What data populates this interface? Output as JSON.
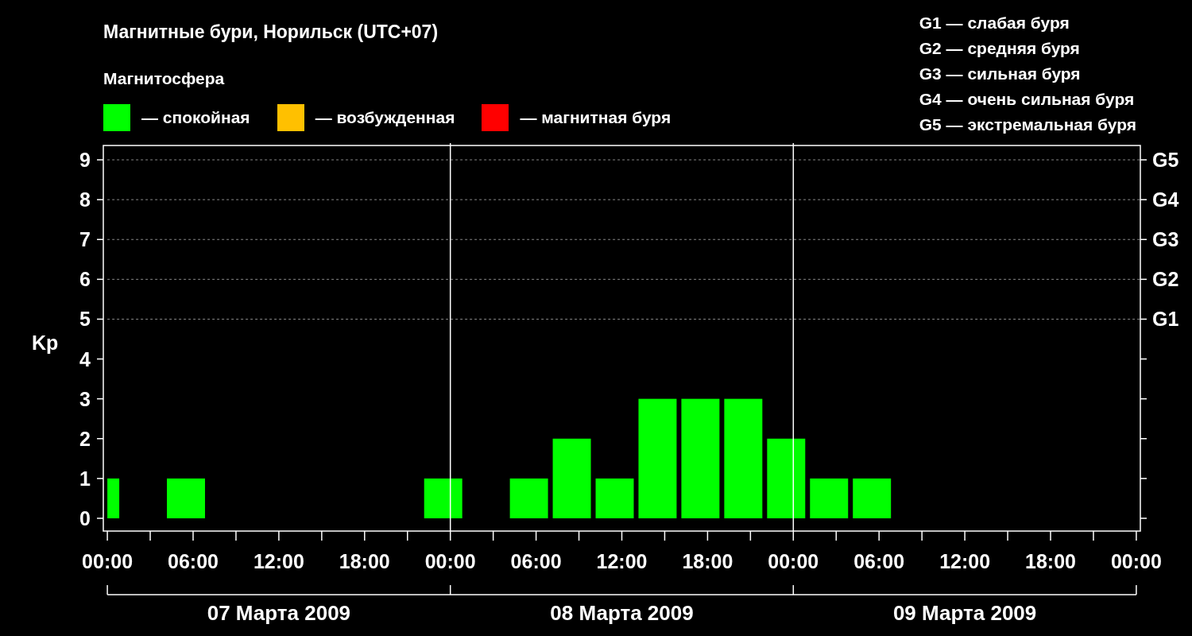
{
  "title": "Магнитные бури, Норильск (UTC+07)",
  "legend": {
    "heading": "Магнитосфера",
    "items": [
      {
        "label": "— спокойная",
        "color": "#00ff00"
      },
      {
        "label": "— возбужденная",
        "color": "#ffc000"
      },
      {
        "label": "— магнитная буря",
        "color": "#ff0000"
      }
    ]
  },
  "g_scale": [
    "G1 — слабая буря",
    "G2 — средняя буря",
    "G3 — сильная буря",
    "G4 — очень сильная буря",
    "G5 — экстремальная буря"
  ],
  "chart": {
    "days": [
      "07 Марта 2009",
      "08 Марта 2009",
      "09 Марта 2009"
    ],
    "storm_levels": [
      "G5",
      "G4",
      "G3",
      "G2",
      "G1"
    ],
    "chart_data": {
      "type": "bar",
      "ylabel": "Kp",
      "grid": true,
      "x": [
        "2009-03-07T00:25",
        "2009-03-07T05:30",
        "2009-03-07T23:30",
        "2009-03-08T05:30",
        "2009-03-08T08:30",
        "2009-03-08T11:30",
        "2009-03-08T14:30",
        "2009-03-08T17:30",
        "2009-03-08T20:30",
        "2009-03-08T23:30",
        "2009-03-09T02:30",
        "2009-03-09T05:30"
      ],
      "xlim": [
        "2009-03-06T23:43",
        "2009-03-10T00:17"
      ],
      "xticks": [
        {
          "value": "2009-03-07T00:00",
          "label": "00:00"
        },
        {
          "value": "2009-03-07T06:00",
          "label": "06:00"
        },
        {
          "value": "2009-03-07T12:00",
          "label": "12:00"
        },
        {
          "value": "2009-03-07T18:00",
          "label": "18:00"
        },
        {
          "value": "2009-03-08T00:00",
          "label": "00:00"
        },
        {
          "value": "2009-03-08T06:00",
          "label": "06:00"
        },
        {
          "value": "2009-03-08T12:00",
          "label": "12:00"
        },
        {
          "value": "2009-03-08T18:00",
          "label": "18:00"
        },
        {
          "value": "2009-03-09T00:00",
          "label": "00:00"
        },
        {
          "value": "2009-03-09T06:00",
          "label": "06:00"
        },
        {
          "value": "2009-03-09T12:00",
          "label": "12:00"
        },
        {
          "value": "2009-03-09T18:00",
          "label": "18:00"
        },
        {
          "value": "2009-03-10T00:00",
          "label": "00:00"
        }
      ],
      "series": [
        {
          "color": "#00ff00",
          "values": [
            1,
            1,
            1,
            1,
            2,
            1,
            3,
            3,
            3,
            2,
            1,
            1
          ]
        }
      ],
      "ylim": [
        -0.32,
        9.36
      ],
      "yticks": [
        0,
        1,
        2,
        3,
        4,
        5,
        6,
        7,
        8,
        9
      ]
    }
  }
}
